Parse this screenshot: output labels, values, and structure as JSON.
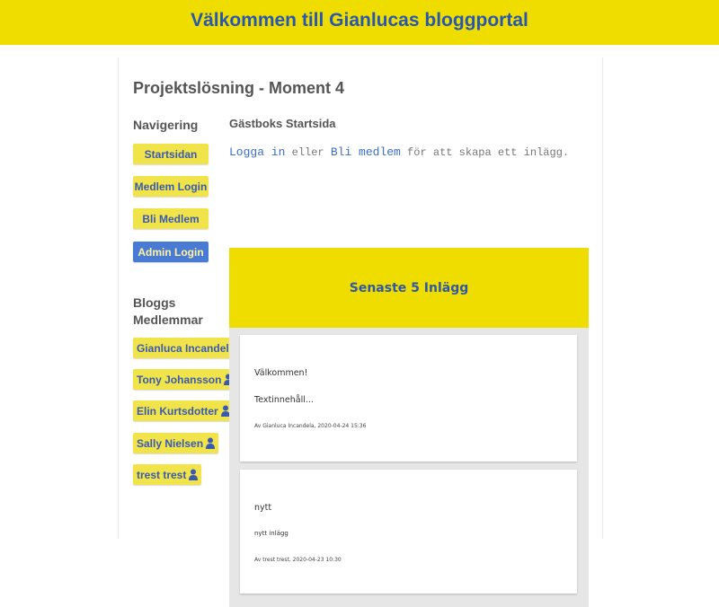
{
  "header": {
    "title": "Välkommen till Gianlucas bloggportal"
  },
  "page": {
    "title": "Projektslösning - Moment 4"
  },
  "sidebar": {
    "nav_heading": "Navigering",
    "nav": [
      "Startsidan",
      "Medlem Login",
      "Bli Medlem",
      "Admin Login"
    ],
    "members_heading_line1": "Bloggs",
    "members_heading_line2": "Medlemmar",
    "members": [
      "Gianluca Incandela",
      "Tony Johansson",
      "Elin Kurtsdotter",
      "Sally Nielsen",
      "trest trest"
    ]
  },
  "main": {
    "heading": "Gästboks Startsida",
    "login_link": "Logga in",
    "login_or": " eller ",
    "register_link": "Bli medlem",
    "login_suffix": " för att skapa ett inlägg.",
    "posts_heading": "Senaste 5 Inlägg",
    "posts": [
      {
        "title": "Välkommen!",
        "content": "Textinnehåll...",
        "meta": "Av Gianluca Incandela, 2020-04-24 15:36"
      },
      {
        "title": "nytt",
        "content": "nytt inlägg",
        "meta": "Av trest trest, 2020-04-23 10:30"
      }
    ]
  },
  "colors": {
    "yellow": "#f0dd00",
    "blue_text": "#2857b0",
    "admin_button": "#4a7bd4",
    "button_yellow": "#f1e34a"
  }
}
